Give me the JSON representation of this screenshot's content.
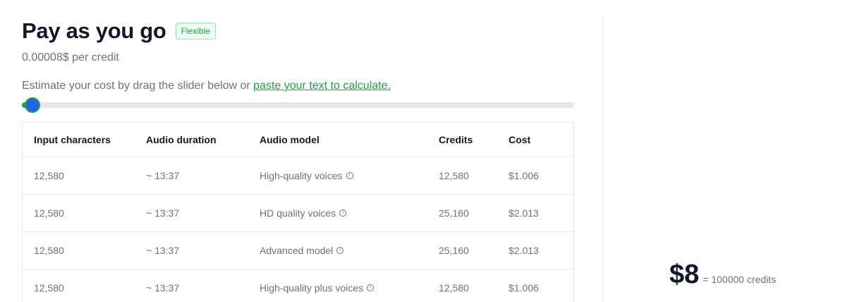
{
  "plan": {
    "title": "Pay as you go",
    "badge": "Flexible",
    "price_per_credit": "0.00008$ per credit"
  },
  "estimate": {
    "text": "Estimate your cost by drag the slider below or ",
    "link": "paste your text to calculate."
  },
  "slider": {
    "value_fraction": 0.02
  },
  "table": {
    "headers": [
      "Input characters",
      "Audio duration",
      "Audio model",
      "Credits",
      "Cost"
    ],
    "rows": [
      {
        "chars": "12,580",
        "duration": "~ 13:37",
        "model": "High-quality voices",
        "credits": "12,580",
        "cost": "$1.006"
      },
      {
        "chars": "12,580",
        "duration": "~ 13:37",
        "model": "HD quality voices",
        "credits": "25,160",
        "cost": "$2.013"
      },
      {
        "chars": "12,580",
        "duration": "~ 13:37",
        "model": "Advanced model",
        "credits": "25,160",
        "cost": "$2.013"
      },
      {
        "chars": "12,580",
        "duration": "~ 13:37",
        "model": "High-quality plus voices",
        "credits": "12,580",
        "cost": "$1.006"
      }
    ]
  },
  "summary": {
    "amount": "$8",
    "credits": "= 100000 credits"
  },
  "icons": {
    "info": "info-icon"
  }
}
